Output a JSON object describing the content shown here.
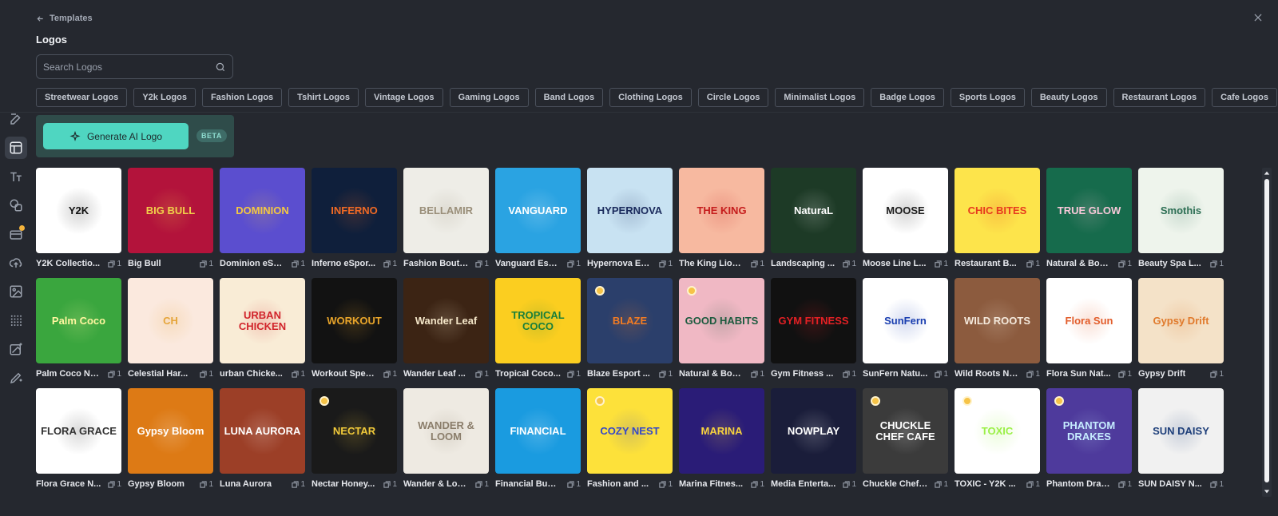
{
  "header": {
    "back_label": "Templates",
    "title": "Logos"
  },
  "search": {
    "placeholder": "Search Logos"
  },
  "categories": [
    "Streetwear Logos",
    "Y2k Logos",
    "Fashion Logos",
    "Tshirt Logos",
    "Vintage Logos",
    "Gaming Logos",
    "Band Logos",
    "Clothing Logos",
    "Circle Logos",
    "Minimalist Logos",
    "Badge Logos",
    "Sports Logos",
    "Beauty Logos",
    "Restaurant Logos",
    "Cafe Logos"
  ],
  "ai": {
    "button_label": "Generate AI Logo",
    "badge": "BETA"
  },
  "rail_icons": [
    "edit-icon",
    "templates-icon",
    "text-icon",
    "elements-icon",
    "brand-kit-icon",
    "upload-icon",
    "images-icon",
    "grid-icon",
    "ai-image-icon",
    "ai-edit-icon"
  ],
  "templates": [
    {
      "name": "Y2K Collectio...",
      "pages": "1",
      "bg": "#ffffff",
      "fg": "#111111",
      "logo": "Y2K"
    },
    {
      "name": "Big Bull",
      "pages": "1",
      "bg": "#b3133b",
      "fg": "#f1d04a",
      "logo": "BIG BULL"
    },
    {
      "name": "Dominion eSp...",
      "pages": "1",
      "bg": "#5b4ecf",
      "fg": "#f4c842",
      "logo": "DOMINION"
    },
    {
      "name": "Inferno eSpor...",
      "pages": "1",
      "bg": "#0f1f3b",
      "fg": "#f06a25",
      "logo": "INFERNO"
    },
    {
      "name": "Fashion Bouti...",
      "pages": "1",
      "bg": "#eeede7",
      "fg": "#9a8f7a",
      "logo": "BELLAMIR"
    },
    {
      "name": "Vanguard Esp...",
      "pages": "1",
      "bg": "#2aa3e2",
      "fg": "#ffffff",
      "logo": "VANGUARD"
    },
    {
      "name": "Hypernova Es...",
      "pages": "1",
      "bg": "#c8e2f2",
      "fg": "#1a2a5c",
      "logo": "HYPERNOVA"
    },
    {
      "name": "The King Lion...",
      "pages": "1",
      "bg": "#f7b9a0",
      "fg": "#c51c1c",
      "logo": "THE KING"
    },
    {
      "name": "Landscaping ...",
      "pages": "1",
      "bg": "#1d3a26",
      "fg": "#ffffff",
      "logo": "NaturaL"
    },
    {
      "name": "Moose Line L...",
      "pages": "1",
      "bg": "#ffffff",
      "fg": "#1b1b1b",
      "logo": "MOOSE"
    },
    {
      "name": "Restaurant B...",
      "pages": "1",
      "bg": "#fde44b",
      "fg": "#e73b1e",
      "logo": "CHIC BITES"
    },
    {
      "name": "Natural & Boh...",
      "pages": "1",
      "bg": "#166b4c",
      "fg": "#f7c9d9",
      "logo": "TRUE GLOW"
    },
    {
      "name": "Beauty Spa L...",
      "pages": "1",
      "bg": "#eef4ec",
      "fg": "#2e6f55",
      "logo": "Smothis"
    },
    {
      "name": "Palm Coco Na...",
      "pages": "1",
      "bg": "#3aa63e",
      "fg": "#fff6a0",
      "logo": "Palm Coco"
    },
    {
      "name": "Celestial Har...",
      "pages": "1",
      "bg": "#fbe9de",
      "fg": "#e5a53a",
      "logo": "CH"
    },
    {
      "name": "urban Chicke...",
      "pages": "1",
      "bg": "#f9ecd6",
      "fg": "#d1242b",
      "logo": "URBAN CHICKEN"
    },
    {
      "name": "Workout Spec...",
      "pages": "1",
      "bg": "#121212",
      "fg": "#e9a52a",
      "logo": "WORKOUT"
    },
    {
      "name": "Wander Leaf ...",
      "pages": "1",
      "bg": "#3c2414",
      "fg": "#f4e6c8",
      "logo": "Wander Leaf"
    },
    {
      "name": "Tropical Coco...",
      "pages": "1",
      "bg": "#fbce20",
      "fg": "#1a7f3a",
      "logo": "TROPICAL COCO"
    },
    {
      "name": "Blaze Esport ...",
      "pages": "1",
      "bg": "#2b3f6b",
      "fg": "#f27c23",
      "logo": "BLAZE",
      "premium": true
    },
    {
      "name": "Natural & Boh...",
      "pages": "1",
      "bg": "#f0b8c4",
      "fg": "#1c5a3e",
      "logo": "GOOD HABITS",
      "premium": true
    },
    {
      "name": "Gym Fitness ...",
      "pages": "1",
      "bg": "#111111",
      "fg": "#e32024",
      "logo": "GYM FITNESS"
    },
    {
      "name": "SunFern Natu...",
      "pages": "1",
      "bg": "#ffffff",
      "fg": "#1b3fb0",
      "logo": "SunFern"
    },
    {
      "name": "Wild Roots Na...",
      "pages": "1",
      "bg": "#8c5b3e",
      "fg": "#f4e9dc",
      "logo": "WILD ROOTS"
    },
    {
      "name": "Flora Sun Nat...",
      "pages": "1",
      "bg": "#ffffff",
      "fg": "#e25d2b",
      "logo": "Flora Sun"
    },
    {
      "name": "Gypsy Drift",
      "pages": "1",
      "bg": "#f4e2c8",
      "fg": "#e07a2c",
      "logo": "Gypsy Drift"
    },
    {
      "name": "Flora Grace N...",
      "pages": "1",
      "bg": "#ffffff",
      "fg": "#333333",
      "logo": "FLORA GRACE"
    },
    {
      "name": "Gypsy Bloom",
      "pages": "1",
      "bg": "#dd7a15",
      "fg": "#ffffff",
      "logo": "Gypsy Bloom"
    },
    {
      "name": "Luna Aurora",
      "pages": "1",
      "bg": "#9c3f27",
      "fg": "#ffffff",
      "logo": "LUNA AURORA"
    },
    {
      "name": "Nectar Honey...",
      "pages": "1",
      "bg": "#1a1a1a",
      "fg": "#f0c93a",
      "logo": "NECTAR",
      "premium": true
    },
    {
      "name": "Wander & Loom",
      "pages": "1",
      "bg": "#eeeae2",
      "fg": "#8a7d6a",
      "logo": "WANDER & LOOM"
    },
    {
      "name": "Financial Busi...",
      "pages": "1",
      "bg": "#1a9be0",
      "fg": "#ffffff",
      "logo": "FINANCIAL"
    },
    {
      "name": "Fashion and ...",
      "pages": "1",
      "bg": "#fde13a",
      "fg": "#3347c9",
      "logo": "COZY NEST",
      "premium": true
    },
    {
      "name": "Marina Fitnes...",
      "pages": "1",
      "bg": "#2a1c77",
      "fg": "#f7d23e",
      "logo": "MARINA"
    },
    {
      "name": "Media Enterta...",
      "pages": "1",
      "bg": "#1a1d3a",
      "fg": "#ffffff",
      "logo": "NOWPLAY"
    },
    {
      "name": "Chuckle Chef ...",
      "pages": "1",
      "bg": "#3b3b3b",
      "fg": "#ffffff",
      "logo": "CHUCKLE CHEF CAFE",
      "premium": true
    },
    {
      "name": "TOXIC - Y2K ...",
      "pages": "1",
      "bg": "#ffffff",
      "fg": "#9bf047",
      "logo": "TOXIC",
      "premium": true
    },
    {
      "name": "Phantom Drak...",
      "pages": "1",
      "bg": "#4e3a9c",
      "fg": "#c6ecff",
      "logo": "PHANTOM DRAKES",
      "premium": true
    },
    {
      "name": "SUN DAISY N...",
      "pages": "1",
      "bg": "#f1f1f1",
      "fg": "#1e3f7a",
      "logo": "SUN DAISY"
    }
  ]
}
